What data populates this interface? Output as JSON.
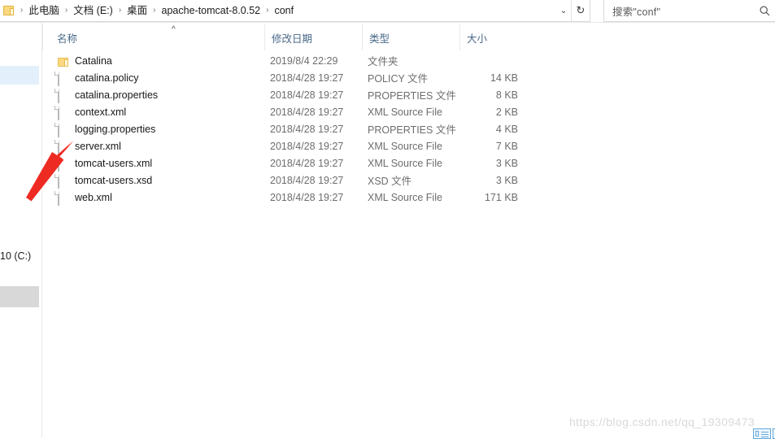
{
  "window": {
    "type": "windows-file-explorer"
  },
  "addressbar": {
    "folder_icon": "folder-icon",
    "breadcrumbs": [
      {
        "label": "此电脑"
      },
      {
        "label": "文档 (E:)"
      },
      {
        "label": "桌面"
      },
      {
        "label": "apache-tomcat-8.0.52"
      },
      {
        "label": "conf"
      }
    ],
    "separator": "›",
    "history_chevron": "⌄",
    "refresh_icon": "↻"
  },
  "search": {
    "placeholder": "搜索\"conf\"",
    "icon": "search-icon"
  },
  "sidebar": {
    "visible_label": "10 (C:)"
  },
  "columns": [
    {
      "key": "name",
      "label": "名称",
      "sorted": "asc",
      "sort_caret": "^"
    },
    {
      "key": "date",
      "label": "修改日期"
    },
    {
      "key": "type",
      "label": "类型"
    },
    {
      "key": "size",
      "label": "大小"
    }
  ],
  "files": [
    {
      "name": "Catalina",
      "icon": "folder-icon",
      "date": "2019/8/4 22:29",
      "type": "文件夹",
      "size": ""
    },
    {
      "name": "catalina.policy",
      "icon": "file-icon",
      "date": "2018/4/28 19:27",
      "type": "POLICY 文件",
      "size": "14 KB"
    },
    {
      "name": "catalina.properties",
      "icon": "file-icon",
      "date": "2018/4/28 19:27",
      "type": "PROPERTIES 文件",
      "size": "8 KB"
    },
    {
      "name": "context.xml",
      "icon": "file-icon",
      "date": "2018/4/28 19:27",
      "type": "XML Source File",
      "size": "2 KB"
    },
    {
      "name": "logging.properties",
      "icon": "file-icon",
      "date": "2018/4/28 19:27",
      "type": "PROPERTIES 文件",
      "size": "4 KB"
    },
    {
      "name": "server.xml",
      "icon": "file-icon",
      "date": "2018/4/28 19:27",
      "type": "XML Source File",
      "size": "7 KB"
    },
    {
      "name": "tomcat-users.xml",
      "icon": "file-icon",
      "date": "2018/4/28 19:27",
      "type": "XML Source File",
      "size": "3 KB"
    },
    {
      "name": "tomcat-users.xsd",
      "icon": "file-icon",
      "date": "2018/4/28 19:27",
      "type": "XSD 文件",
      "size": "3 KB"
    },
    {
      "name": "web.xml",
      "icon": "file-icon",
      "date": "2018/4/28 19:27",
      "type": "XML Source File",
      "size": "171 KB"
    }
  ],
  "annotation": {
    "arrow_color": "#ee2b22",
    "points_to": "server.xml"
  },
  "watermark": {
    "text": "https://blog.csdn.net/qq_19309473"
  },
  "colors": {
    "header_text": "#4a6a8a",
    "selection": "#e3f0fb",
    "folder": "#fcd980"
  }
}
